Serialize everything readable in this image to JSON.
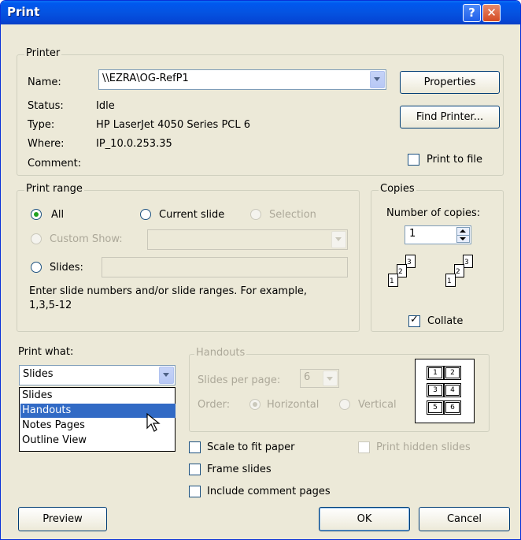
{
  "window": {
    "title": "Print",
    "help_glyph": "?",
    "close_glyph": "✕"
  },
  "printer": {
    "legend": "Printer",
    "name_label": "Name:",
    "name_value": "\\\\EZRA\\OG-RefP1",
    "status_label": "Status:",
    "status_value": "Idle",
    "type_label": "Type:",
    "type_value": "HP LaserJet 4050 Series PCL 6",
    "where_label": "Where:",
    "where_value": "IP_10.0.253.35",
    "comment_label": "Comment:",
    "properties_button": "Properties",
    "find_printer_button": "Find Printer...",
    "print_to_file_label": "Print to file",
    "print_to_file_checked": false
  },
  "print_range": {
    "legend": "Print range",
    "all_label": "All",
    "current_slide_label": "Current slide",
    "selection_label": "Selection",
    "custom_show_label": "Custom Show:",
    "slides_label": "Slides:",
    "slides_value": "",
    "hint": "Enter slide numbers and/or slide ranges. For example,",
    "hint_example": "1,3,5-12",
    "selected": "All"
  },
  "copies": {
    "legend": "Copies",
    "number_label": "Number of copies:",
    "number_value": "1",
    "collate_label": "Collate",
    "collate_checked": true,
    "page_numbers": [
      "1",
      "2",
      "3"
    ]
  },
  "print_what": {
    "label": "Print what:",
    "selected": "Slides",
    "options": [
      "Slides",
      "Handouts",
      "Notes Pages",
      "Outline View"
    ],
    "highlighted": "Handouts"
  },
  "handouts": {
    "legend": "Handouts",
    "slides_per_page_label": "Slides per page:",
    "slides_per_page_value": "6",
    "order_label": "Order:",
    "horizontal_label": "Horizontal",
    "vertical_label": "Vertical",
    "preview_numbers": [
      "1",
      "2",
      "3",
      "4",
      "5",
      "6"
    ]
  },
  "options": {
    "scale_to_fit_label": "Scale to fit paper",
    "frame_slides_label": "Frame slides",
    "include_comments_label": "Include comment pages",
    "print_hidden_label": "Print hidden slides"
  },
  "buttons": {
    "preview": "Preview",
    "ok": "OK",
    "cancel": "Cancel"
  },
  "colors": {
    "titlebar": "#0553e1",
    "dialog_bg": "#ece9d8",
    "selection": "#316ac5",
    "check_green": "#21a121"
  }
}
